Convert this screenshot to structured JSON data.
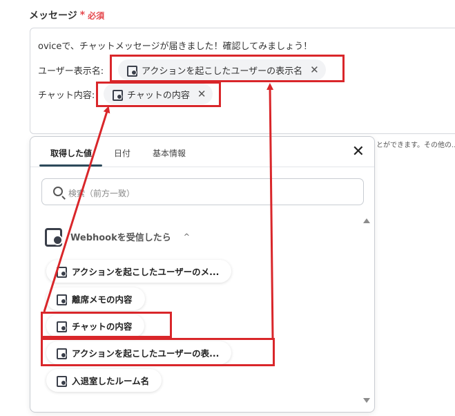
{
  "field": {
    "label": "メッセージ",
    "required_star": "*",
    "required_text": "必須"
  },
  "editor": {
    "line1": "oviceで、チャットメッセージが届きました！確認してみましょう！",
    "line2_prefix": "ユーザー表示名:",
    "line3_prefix": "チャット内容:",
    "chip1_label": "アクションを起こしたユーザーの表示名",
    "chip2_label": "チャットの内容",
    "chip_remove": "✕"
  },
  "hint_text": "とができます。その他の...",
  "popup": {
    "tabs": [
      "取得した値",
      "日付",
      "基本情報"
    ],
    "close": "✕",
    "search_placeholder": "検索（前方一致）",
    "group_label": "Webhookを受信したら",
    "group_chevron": "^",
    "items": [
      "アクションを起こしたユーザーのメ...",
      "離席メモの内容",
      "チャットの内容",
      "アクションを起こしたユーザーの表...",
      "入退室したルーム名"
    ]
  },
  "colors": {
    "highlight_red": "#d9262a",
    "required_red": "#e5484d",
    "tab_indicator": "#2d4a5a"
  },
  "icons": {
    "field_icon": "webhook-icon",
    "search": "search-icon",
    "close": "close-icon"
  }
}
